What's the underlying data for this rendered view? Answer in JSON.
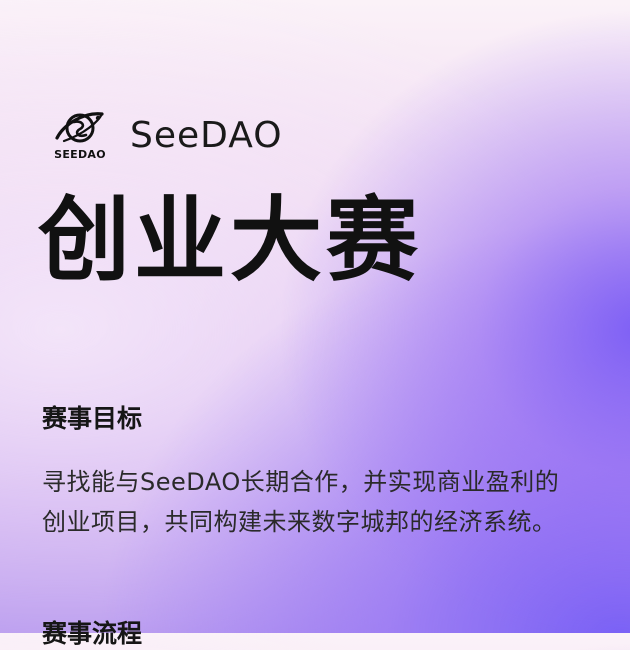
{
  "brand": {
    "logo_icon": "planet-ring-logo-icon",
    "logo_text": "SEEDAO",
    "name": "SeeDAO"
  },
  "hero": {
    "title": "创业大赛"
  },
  "goal_section": {
    "heading": "赛事目标",
    "body_lines": [
      "寻找能与SeeDAO长期合作，并实现商业盈利的",
      "创业项目，共同构建未来数字城邦的经济系统。"
    ]
  },
  "next_section": {
    "heading": "赛事流程"
  },
  "colors": {
    "text_primary": "#111111",
    "accent_purple": "#7a5cf5",
    "background_light": "#fbf2f8"
  }
}
